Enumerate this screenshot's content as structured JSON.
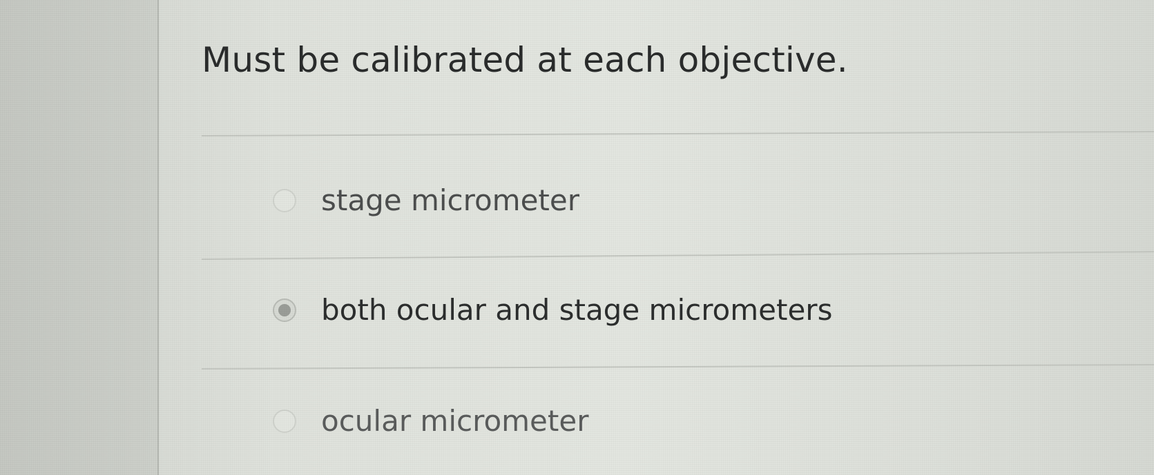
{
  "question": {
    "text": "Must be calibrated at each objective."
  },
  "options": [
    {
      "label": "stage micrometer",
      "selected": false
    },
    {
      "label": "both ocular and stage micrometers",
      "selected": true
    },
    {
      "label": "ocular micrometer",
      "selected": false
    }
  ],
  "colors": {
    "text_primary": "#2a2c2c",
    "text_option": "#4c4e4e",
    "radio_dot": "#9a9d98"
  }
}
